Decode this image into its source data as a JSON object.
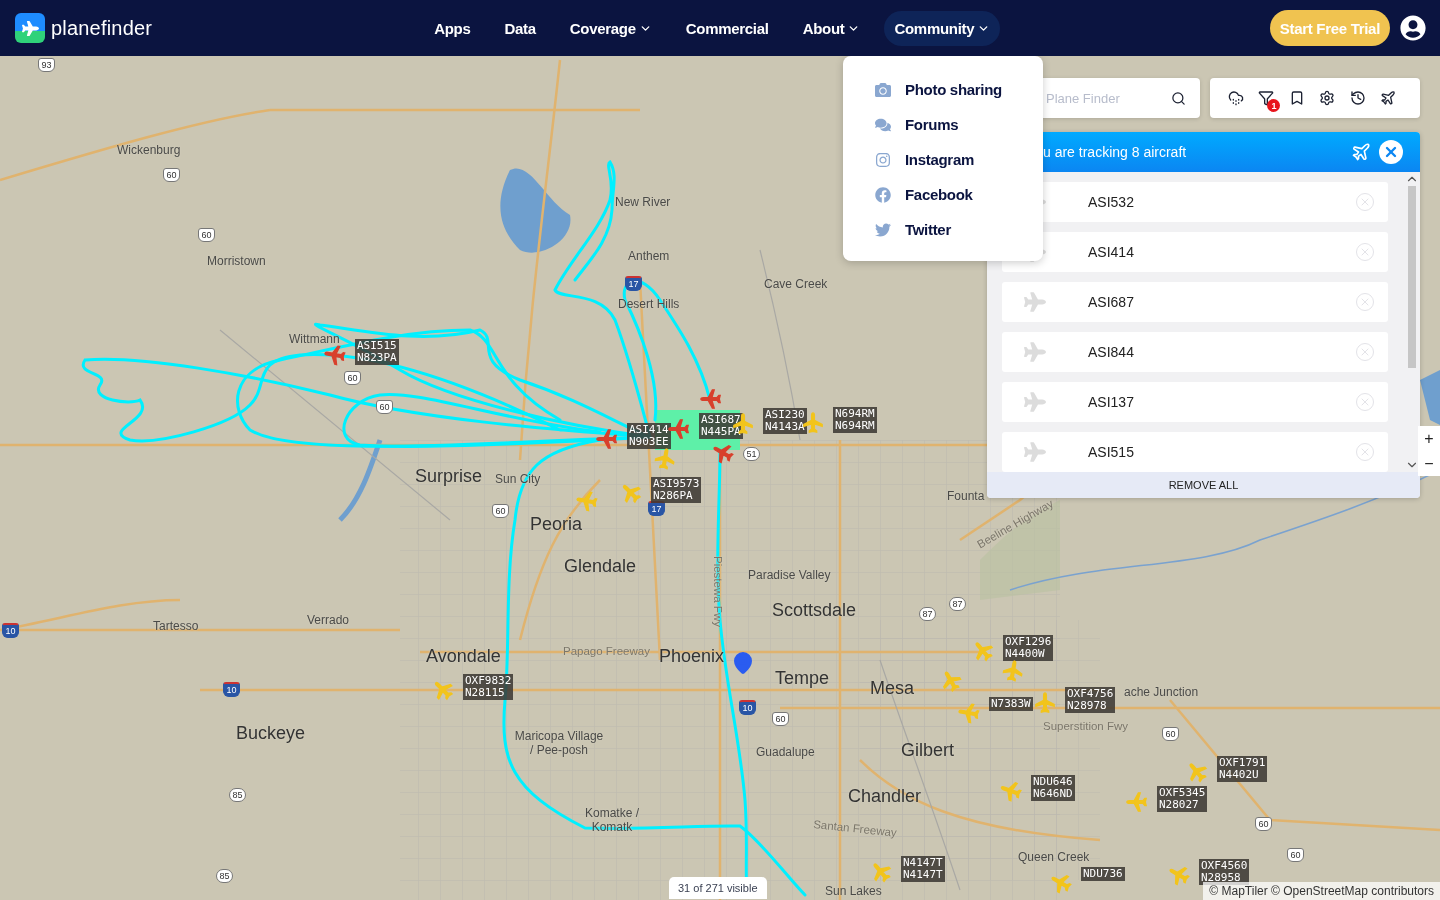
{
  "header": {
    "logo": "**plane**finder",
    "cta": "Start Free Trial",
    "nav": [
      {
        "label": "Apps",
        "dropdown": false,
        "selected": false
      },
      {
        "label": "Data",
        "dropdown": false,
        "selected": false
      },
      {
        "label": "Coverage",
        "dropdown": true,
        "selected": false
      },
      {
        "label": "Commercial",
        "dropdown": false,
        "selected": false
      },
      {
        "label": "About",
        "dropdown": true,
        "selected": false
      },
      {
        "label": "Community",
        "dropdown": true,
        "selected": true
      }
    ]
  },
  "community_menu": [
    {
      "kind": "photo",
      "label": "Photo sharing"
    },
    {
      "kind": "forums",
      "label": "Forums"
    },
    {
      "kind": "instagram",
      "label": "Instagram"
    },
    {
      "kind": "facebook",
      "label": "Facebook"
    },
    {
      "kind": "twitter",
      "label": "Twitter"
    }
  ],
  "search": {
    "placeholder": "Plane Finder"
  },
  "toolbar": {
    "filter_badge": "1"
  },
  "tracking_panel": {
    "title": "u are tracking 8 aircraft",
    "aircraft": [
      "ASI532",
      "ASI414",
      "ASI687",
      "ASI844",
      "ASI137",
      "ASI515"
    ],
    "remove_all": "REMOVE ALL"
  },
  "map": {
    "places": [
      {
        "kind": "town",
        "name": "Wickenburg"
      },
      {
        "kind": "town",
        "name": "Morristown"
      },
      {
        "kind": "town",
        "name": "Wittmann"
      },
      {
        "kind": "town",
        "name": "New River"
      },
      {
        "kind": "town",
        "name": "Anthem"
      },
      {
        "kind": "town",
        "name": "Desert Hills"
      },
      {
        "kind": "town",
        "name": "Cave Creek"
      },
      {
        "kind": "city",
        "name": "Surprise"
      },
      {
        "kind": "town",
        "name": "Sun City"
      },
      {
        "kind": "city",
        "name": "Peoria"
      },
      {
        "kind": "town",
        "name": "Founta"
      },
      {
        "kind": "road",
        "name": "Beeline Highway"
      },
      {
        "kind": "city",
        "name": "Glendale"
      },
      {
        "kind": "road",
        "name": "Piestewa Fwy"
      },
      {
        "kind": "town",
        "name": "Paradise Valley"
      },
      {
        "kind": "city",
        "name": "Scottsdale"
      },
      {
        "kind": "town",
        "name": "Tartesso"
      },
      {
        "kind": "town",
        "name": "Verrado"
      },
      {
        "kind": "city",
        "name": "Avondale"
      },
      {
        "kind": "road",
        "name": "Papago Freeway"
      },
      {
        "kind": "city",
        "name": "Phoenix"
      },
      {
        "kind": "city",
        "name": "Tempe"
      },
      {
        "kind": "city",
        "name": "Mesa"
      },
      {
        "kind": "town",
        "name": "ache Junction"
      },
      {
        "kind": "road",
        "name": "Superstition Fwy"
      },
      {
        "kind": "city",
        "name": "Buckeye"
      },
      {
        "kind": "town",
        "name": "Maricopa Village / Pee-posh"
      },
      {
        "kind": "town",
        "name": "Guadalupe"
      },
      {
        "kind": "city",
        "name": "Gilbert"
      },
      {
        "kind": "city",
        "name": "Chandler"
      },
      {
        "kind": "road",
        "name": "Santan Freeway"
      },
      {
        "kind": "town",
        "name": "Komatke / Komatk"
      },
      {
        "kind": "town",
        "name": "Queen Creek"
      },
      {
        "kind": "town",
        "name": "Sun Lakes"
      }
    ],
    "shields": [
      {
        "kind": "us",
        "number": "93"
      },
      {
        "kind": "us",
        "number": "60"
      },
      {
        "kind": "us",
        "number": "60"
      },
      {
        "kind": "us",
        "number": "60"
      },
      {
        "kind": "us",
        "number": "60"
      },
      {
        "kind": "interstate",
        "number": "17"
      },
      {
        "kind": "state",
        "number": "51"
      },
      {
        "kind": "us",
        "number": "60"
      },
      {
        "kind": "interstate",
        "number": "17"
      },
      {
        "kind": "state",
        "number": "87"
      },
      {
        "kind": "state",
        "number": "87"
      },
      {
        "kind": "interstate",
        "number": "10"
      },
      {
        "kind": "interstate",
        "number": "10"
      },
      {
        "kind": "interstate",
        "number": "10"
      },
      {
        "kind": "us",
        "number": "60"
      },
      {
        "kind": "us",
        "number": "60"
      },
      {
        "kind": "us",
        "number": "60"
      },
      {
        "kind": "us",
        "number": "60"
      },
      {
        "kind": "state",
        "number": "85"
      },
      {
        "kind": "state",
        "number": "85"
      }
    ],
    "aircraft": [
      {
        "color": "#d8402c",
        "callsign": "ASI515",
        "registration": "N823PA"
      },
      {
        "color": "#d8402c",
        "callsign": "ASI414",
        "registration": "N903EE"
      },
      {
        "color": "#d8402c",
        "callsign": "ASI687",
        "registration": "N445PA"
      },
      {
        "color": "#f2c41c",
        "callsign": "ASI230",
        "registration": "N4143A"
      },
      {
        "color": "#f2c41c",
        "callsign": "N694RM",
        "registration": "N694RM"
      },
      {
        "color": "#f2c41c",
        "callsign": "ASI9573",
        "registration": "N286PA"
      },
      {
        "color": "#f2c41c",
        "callsign": "OXF9832",
        "registration": "N28115"
      },
      {
        "color": "#f2c41c",
        "callsign": "OXF1296",
        "registration": "N4400W"
      },
      {
        "color": "#f2c41c",
        "callsign": "N7383W"
      },
      {
        "color": "#f2c41c",
        "callsign": "OXF4756",
        "registration": "N28978"
      },
      {
        "color": "#f2c41c",
        "callsign": "OXF1791",
        "registration": "N4402U"
      },
      {
        "color": "#f2c41c",
        "callsign": "NDU646",
        "registration": "N646ND"
      },
      {
        "color": "#f2c41c",
        "callsign": "OXF5345",
        "registration": "N28027"
      },
      {
        "color": "#f2c41c",
        "callsign": "N4147T",
        "registration": "N4147T"
      },
      {
        "color": "#f2c41c",
        "callsign": "NDU736"
      },
      {
        "color": "#f2c41c",
        "callsign": "OXF4560",
        "registration": "N28958"
      },
      {
        "color": "#f2c41c"
      },
      {
        "color": "#d8402c"
      },
      {
        "color": "#f2c41c"
      },
      {
        "color": "#d8402c"
      },
      {
        "color": "#f2c41c"
      },
      {
        "color": "#f2c41c"
      }
    ],
    "zoom_controls": [
      "+",
      "−"
    ],
    "visible_count": "31 of 271 visible",
    "attribution": "© MapTiler © OpenStreetMap contributors"
  }
}
